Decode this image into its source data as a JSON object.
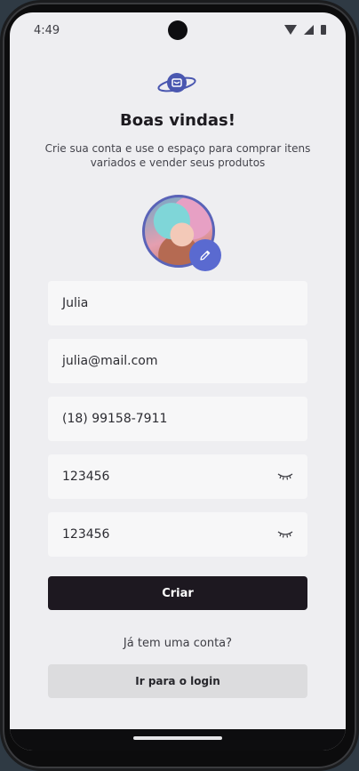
{
  "status_bar": {
    "time": "4:49"
  },
  "header": {
    "title": "Boas vindas!",
    "subtitle": "Crie sua conta e use o espaço para comprar itens variados e vender seus produtos"
  },
  "form": {
    "name": "Julia",
    "email": "julia@mail.com",
    "phone": "(18) 99158-7911",
    "password": "123456",
    "password_confirm": "123456"
  },
  "actions": {
    "create_label": "Criar",
    "have_account_text": "Já tem uma conta?",
    "login_label": "Ir para o login"
  },
  "colors": {
    "accent": "#5a6ad0",
    "primary_button": "#1d1820",
    "secondary_button": "#dcdcde",
    "background": "#eeeef1"
  },
  "icons": {
    "logo": "shopping-planet-icon",
    "edit": "pencil-icon",
    "password_toggle": "eye-closed-icon"
  }
}
